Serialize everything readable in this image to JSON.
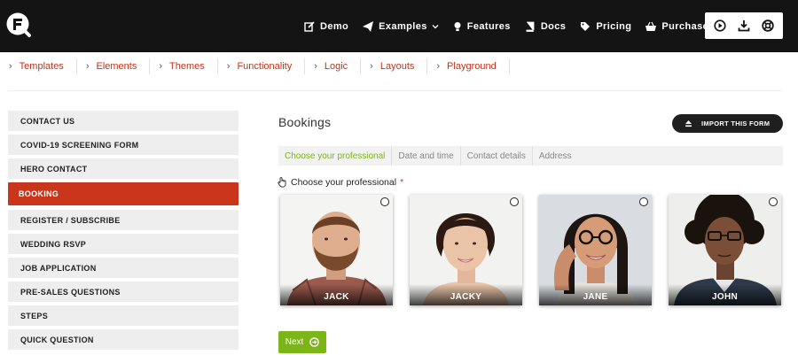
{
  "nav": {
    "links": [
      {
        "label": "Demo",
        "icon": "edit-icon"
      },
      {
        "label": "Examples",
        "icon": "paper-plane-icon"
      },
      {
        "label": "Features",
        "icon": "lightbulb-icon"
      },
      {
        "label": "Docs",
        "icon": "book-icon"
      },
      {
        "label": "Pricing",
        "icon": "tag-icon"
      },
      {
        "label": "Purchase",
        "icon": "shopping-basket-icon"
      }
    ],
    "tools": [
      "play-icon",
      "download-icon",
      "lifebuoy-icon"
    ]
  },
  "breadcrumbs": [
    "Templates",
    "Elements",
    "Themes",
    "Functionality",
    "Logic",
    "Layouts",
    "Playground"
  ],
  "sidebar": {
    "items": [
      {
        "label": "CONTACT US"
      },
      {
        "label": "COVID-19 SCREENING FORM"
      },
      {
        "label": "HERO CONTACT"
      },
      {
        "label": "BOOKING",
        "active": true
      },
      {
        "label": "REGISTER / SUBSCRIBE"
      },
      {
        "label": "WEDDING RSVP"
      },
      {
        "label": "JOB APPLICATION"
      },
      {
        "label": "PRE-SALES QUESTIONS"
      },
      {
        "label": "STEPS"
      },
      {
        "label": "QUICK QUESTION"
      }
    ]
  },
  "form": {
    "title": "Bookings",
    "import_label": "IMPORT THIS FORM",
    "steps": [
      "Choose your professional",
      "Date and time",
      "Contact details",
      "Address"
    ],
    "active_step": 0,
    "field_label": "Choose your professional",
    "required_mark": "*",
    "professionals": [
      {
        "name": "JACK"
      },
      {
        "name": "JACKY"
      },
      {
        "name": "JANE"
      },
      {
        "name": "JOHN"
      }
    ],
    "next_label": "Next"
  },
  "colors": {
    "topbar": "#141414",
    "accent_red": "#c9361b",
    "link_red": "#c0331a",
    "accent_green": "#7cb518"
  }
}
